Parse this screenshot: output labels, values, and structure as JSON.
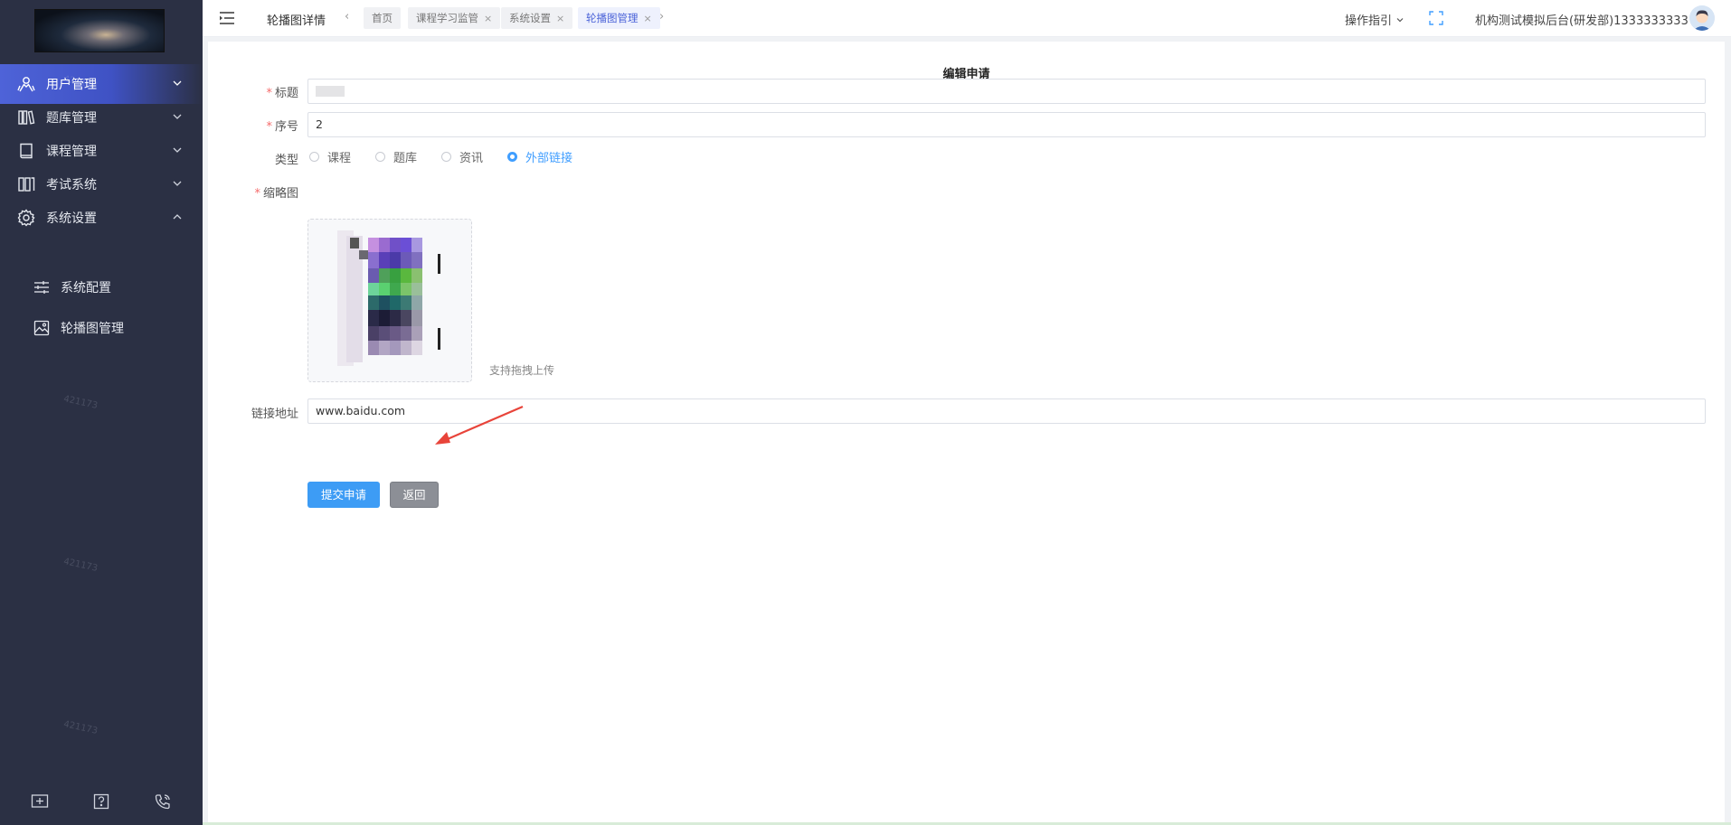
{
  "sidebar": {
    "menu": [
      {
        "label": "用户管理",
        "icon": "users-icon",
        "active": true
      },
      {
        "label": "题库管理",
        "icon": "books-icon"
      },
      {
        "label": "课程管理",
        "icon": "book-icon"
      },
      {
        "label": "考试系统",
        "icon": "exam-icon"
      },
      {
        "label": "系统设置",
        "icon": "gear-icon",
        "expanded": true
      }
    ],
    "submenu": [
      {
        "label": "系统配置",
        "icon": "sliders-icon"
      },
      {
        "label": "轮播图管理",
        "icon": "image-icon"
      }
    ],
    "watermark": "421173",
    "bottom_icons": [
      "screen-icon",
      "help-icon",
      "phone-icon"
    ]
  },
  "topbar": {
    "page_name": "轮播图详情",
    "tabs": [
      {
        "label": "首页",
        "closable": false,
        "active": false
      },
      {
        "label": "课程学习监管",
        "closable": true,
        "active": false
      },
      {
        "label": "系统设置",
        "closable": true,
        "active": false
      },
      {
        "label": "轮播图管理",
        "closable": true,
        "active": true
      }
    ],
    "close_glyph": "×",
    "prev_glyph": "‹",
    "next_glyph": "›",
    "guide_label": "操作指引",
    "user_text": "机构测试模拟后台(研发部)1333333333"
  },
  "form": {
    "title": "编辑申请",
    "title_label": "标题",
    "order_label": "序号",
    "order_value": "2",
    "type_label": "类型",
    "type_options": [
      "课程",
      "题库",
      "资讯",
      "外部链接"
    ],
    "type_selected": 3,
    "thumb_label": "缩略图",
    "upload_hint": "支持拖拽上传",
    "link_label": "链接地址",
    "link_value": "www.baidu.com",
    "submit_label": "提交申请",
    "back_label": "返回"
  },
  "colors": {
    "sidebar_bg": "#2b3044",
    "active_menu": "#4e63d8",
    "primary": "#409eff",
    "required": "#f56c6c"
  }
}
